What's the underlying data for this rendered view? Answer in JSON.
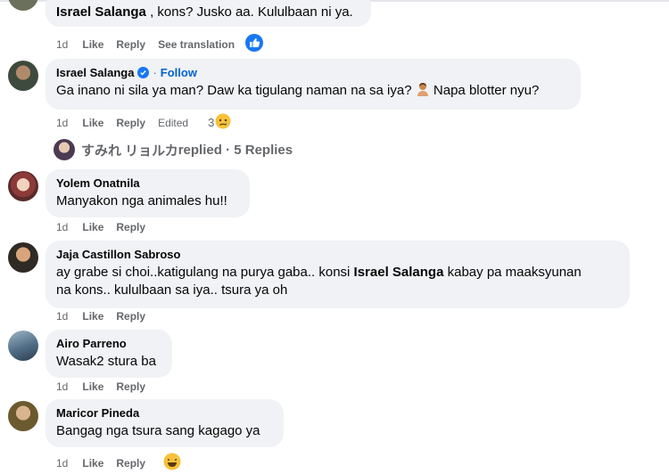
{
  "comments": [
    {
      "name": "Israel Salanga",
      "text_after": " , kons? Jusko aa. Kululbaan ni ya.",
      "time": "1d",
      "like": "Like",
      "reply": "Reply",
      "extra": "See translation"
    },
    {
      "name": "Israel Salanga",
      "dot": "·",
      "follow": "Follow",
      "text_a": "Ga inano ni sila ya man? Daw ka tigulang naman na sa iya? ",
      "text_b": " Napa blotter nyu?",
      "time": "1d",
      "like": "Like",
      "reply": "Reply",
      "extra": "Edited",
      "reaction_count": "3"
    },
    {
      "name": "Yolem Onatnila",
      "text": "Manyakon nga animales hu!!",
      "time": "1d",
      "like": "Like",
      "reply": "Reply"
    },
    {
      "name": "Jaja Castillon Sabroso",
      "text_a": "ay grabe si choi..katigulang na purya gaba.. konsi ",
      "mention": "Israel Salanga",
      "text_b": " kabay pa maaksyunan",
      "text_line2": "na kons.. kululbaan sa iya.. tsura ya oh",
      "time": "1d",
      "like": "Like",
      "reply": "Reply"
    },
    {
      "name": "Airo Parreno",
      "text": "Wasak2 stura ba",
      "time": "1d",
      "like": "Like",
      "reply": "Reply"
    },
    {
      "name": "Maricor Pineda",
      "text": "Bangag nga tsura sang kagago ya",
      "time": "1d",
      "like": "Like",
      "reply": "Reply"
    }
  ],
  "replies_link": {
    "user": "すみれ リョルカ",
    "text": " replied · 5 Replies"
  },
  "colors": {
    "bubble": "#f0f2f5",
    "meta": "#65676b",
    "link": "#0064d1",
    "like_blue": "#1877f2"
  }
}
